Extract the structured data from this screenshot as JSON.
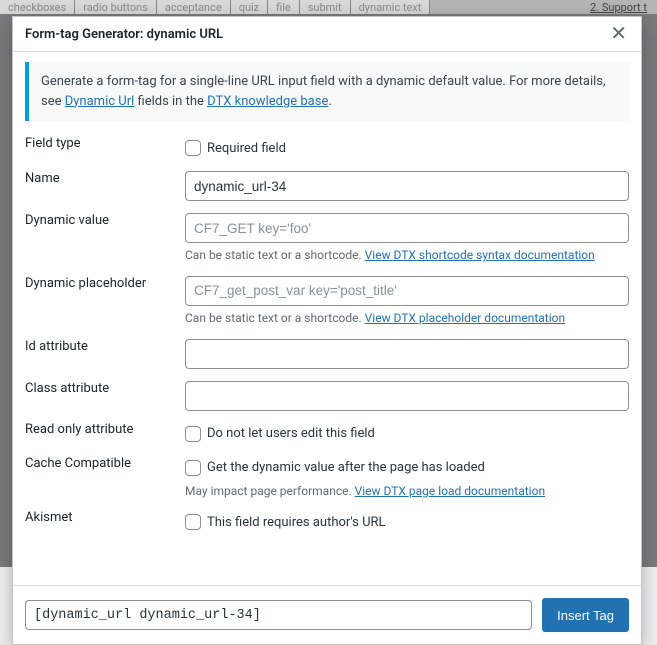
{
  "background_tabs": [
    "checkboxes",
    "radio buttons",
    "acceptance",
    "quiz",
    "file",
    "submit",
    "dynamic text"
  ],
  "support_link": "2. Support t",
  "dialog": {
    "title": "Form-tag Generator: dynamic URL",
    "info_prefix": "Generate a form-tag for a single-line URL input field with a dynamic default value. For more details, see ",
    "info_link1": "Dynamic Url",
    "info_mid": " fields in the ",
    "info_link2": "DTX knowledge base",
    "info_suffix": "."
  },
  "fields": {
    "field_type_label": "Field type",
    "required_label": "Required field",
    "name_label": "Name",
    "name_value": "dynamic_url-34",
    "dyn_value_label": "Dynamic value",
    "dyn_value_placeholder": "CF7_GET key='foo'",
    "dyn_value_help_pre": "Can be static text or a shortcode. ",
    "dyn_value_help_link": "View DTX shortcode syntax documentation",
    "dyn_ph_label": "Dynamic placeholder",
    "dyn_ph_placeholder": "CF7_get_post_var key='post_title'",
    "dyn_ph_help_pre": "Can be static text or a shortcode. ",
    "dyn_ph_help_link": "View DTX placeholder documentation",
    "id_label": "Id attribute",
    "class_label": "Class attribute",
    "readonly_label": "Read only attribute",
    "readonly_check": "Do not let users edit this field",
    "cache_label": "Cache Compatible",
    "cache_check": "Get the dynamic value after the page has loaded",
    "cache_help_pre": "May impact page performance. ",
    "cache_help_link": "View DTX page load documentation",
    "akismet_label": "Akismet",
    "akismet_check": "This field requires author's URL"
  },
  "footer": {
    "tag": "[dynamic_url dynamic_url-34]",
    "insert_label": "Insert Tag"
  }
}
